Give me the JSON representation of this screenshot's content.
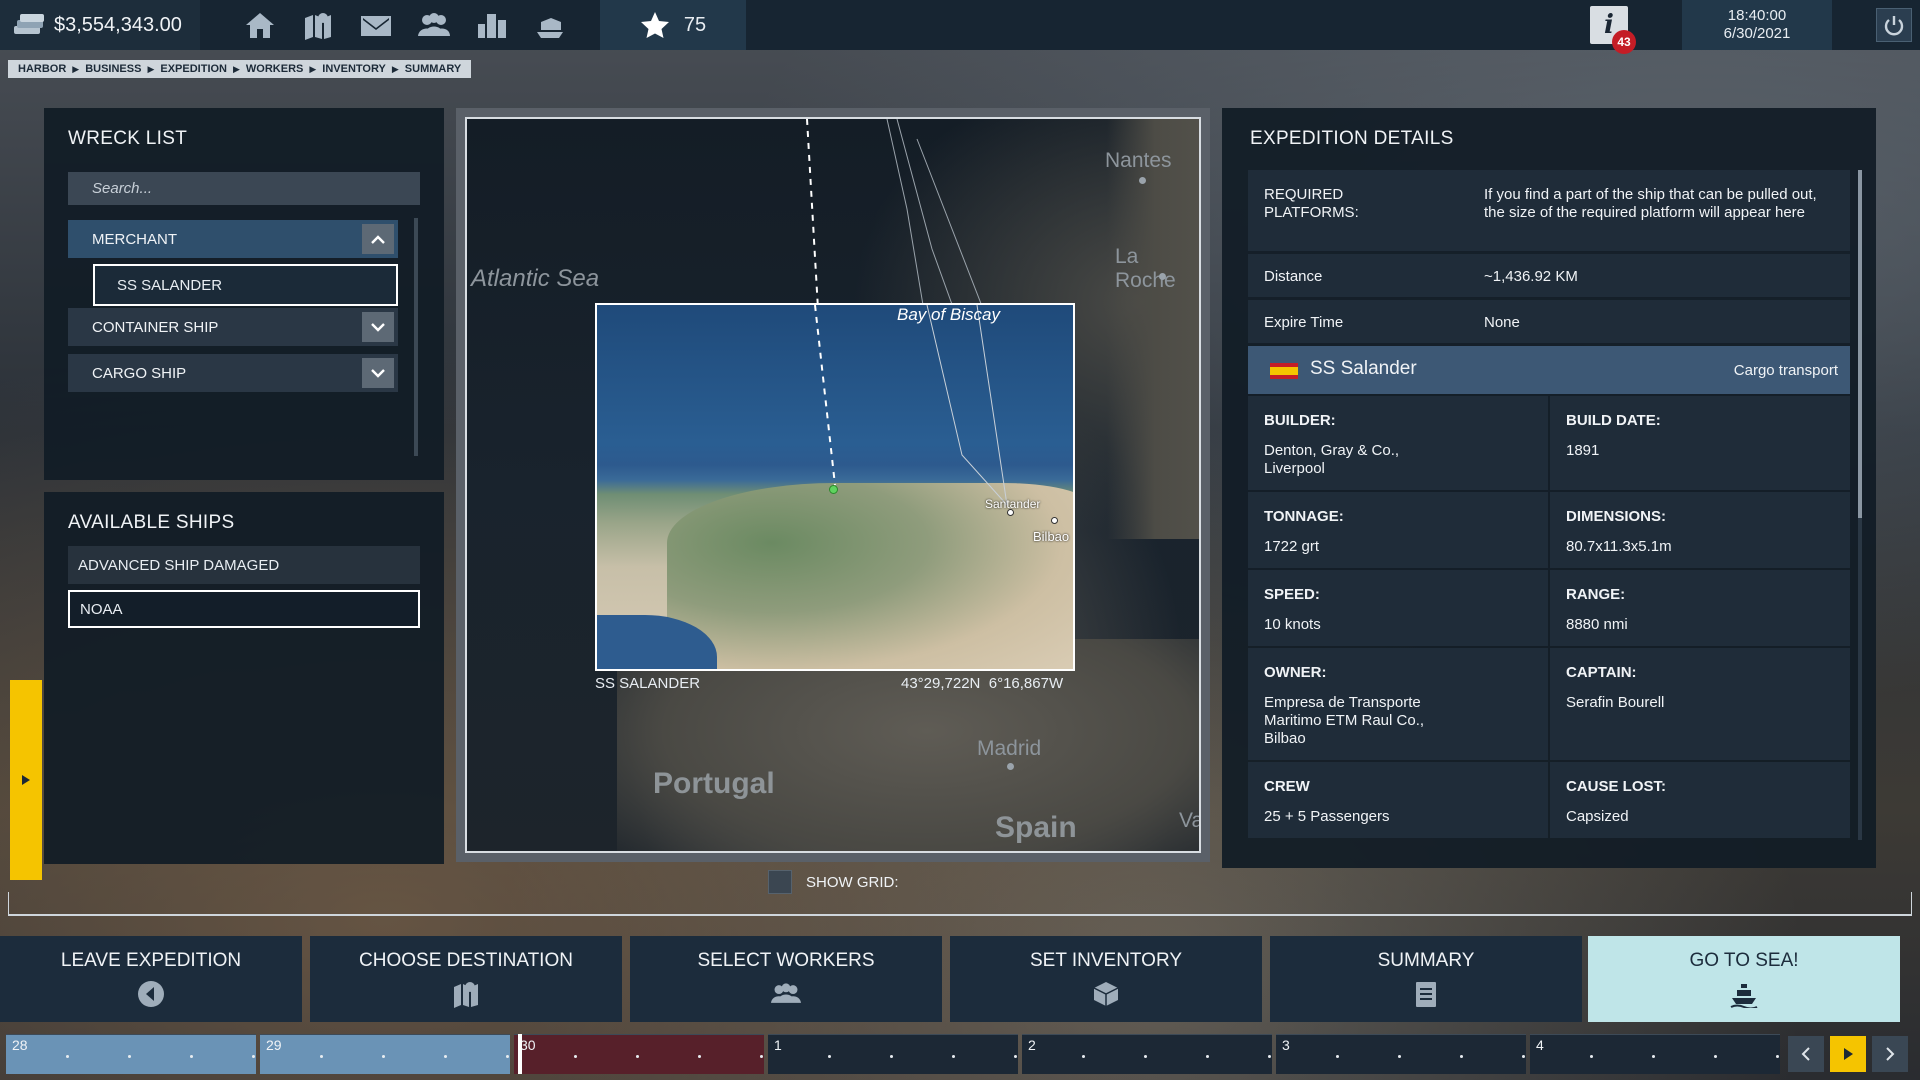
{
  "topbar": {
    "money": "$3,554,343.00",
    "stars": "75",
    "notifications": "43",
    "time": "18:40:00",
    "date": "6/30/2021",
    "nav_icons": [
      "home-icon",
      "map-icon",
      "mail-icon",
      "people-icon",
      "city-icon",
      "harbor-icon"
    ]
  },
  "breadcrumb": [
    "HARBOR",
    "BUSINESS",
    "EXPEDITION",
    "WORKERS",
    "INVENTORY",
    "SUMMARY"
  ],
  "wreck_list": {
    "title": "WRECK LIST",
    "search_placeholder": "Search...",
    "categories": [
      {
        "label": "MERCHANT",
        "open": true
      },
      {
        "label": "CONTAINER SHIP",
        "open": false
      },
      {
        "label": "CARGO SHIP",
        "open": false
      }
    ],
    "selected_wreck": "SS SALANDER"
  },
  "available_ships": {
    "title": "AVAILABLE SHIPS",
    "items": [
      "ADVANCED SHIP DAMAGED",
      "NOAA"
    ],
    "selected": "NOAA"
  },
  "map": {
    "labels": {
      "atlantic": "Atlantic Sea",
      "nantes": "Nantes",
      "la_roche": "La Roche",
      "madrid": "Madrid",
      "portugal": "Portugal",
      "spain": "Spain",
      "va": "Va"
    },
    "zoom": {
      "bay": "Bay of Biscay",
      "santander": "Santander",
      "bilbao": "Bilbao"
    },
    "wreck_name": "SS SALANDER",
    "coords": "43°29,722N  6°16,867W",
    "show_grid_label": "SHOW GRID:",
    "show_grid": false
  },
  "details": {
    "title": "EXPEDITION DETAILS",
    "required_platforms_label": "REQUIRED PLATFORMS:",
    "required_platforms_value": "If you find a part of the ship that can be pulled out, the size of the required platform will appear here",
    "distance_label": "Distance",
    "distance_value": "~1,436.92 KM",
    "expire_label": "Expire Time",
    "expire_value": "None",
    "ship_name": "SS Salander",
    "ship_type": "Cargo transport",
    "builder_label": "BUILDER:",
    "builder_value": "Denton, Gray & Co., Liverpool",
    "build_date_label": "BUILD DATE:",
    "build_date_value": "1891",
    "tonnage_label": "TONNAGE:",
    "tonnage_value": "1722 grt",
    "dimensions_label": "DIMENSIONS:",
    "dimensions_value": "80.7x11.3x5.1m",
    "speed_label": "SPEED:",
    "speed_value": "10 knots",
    "range_label": "RANGE:",
    "range_value": "8880 nmi",
    "owner_label": "OWNER:",
    "owner_value": "Empresa de Transporte Maritimo ETM Raul Co., Bilbao",
    "captain_label": "CAPTAIN:",
    "captain_value": "Serafin Bourell",
    "crew_label": "CREW",
    "crew_value": "25 + 5 Passengers",
    "cause_label": "CAUSE LOST:",
    "cause_value": "Capsized"
  },
  "steps": [
    {
      "label": "LEAVE EXPEDITION",
      "icon": "back-arrow-icon"
    },
    {
      "label": "CHOOSE DESTINATION",
      "icon": "map-icon"
    },
    {
      "label": "SELECT WORKERS",
      "icon": "people-icon"
    },
    {
      "label": "SET INVENTORY",
      "icon": "boxes-icon"
    },
    {
      "label": "SUMMARY",
      "icon": "clipboard-icon"
    },
    {
      "label": "GO TO SEA!",
      "icon": "ship-icon"
    }
  ],
  "timeline": {
    "days": [
      "28",
      "29",
      "30",
      "1",
      "2",
      "3",
      "4"
    ],
    "today_index": 2
  },
  "colors": {
    "accent_yellow": "#f5c400",
    "panel_bg": "#111c26",
    "go_button": "#bfe5e8",
    "today_red": "#57202a",
    "past_blue": "#6a93b6"
  }
}
